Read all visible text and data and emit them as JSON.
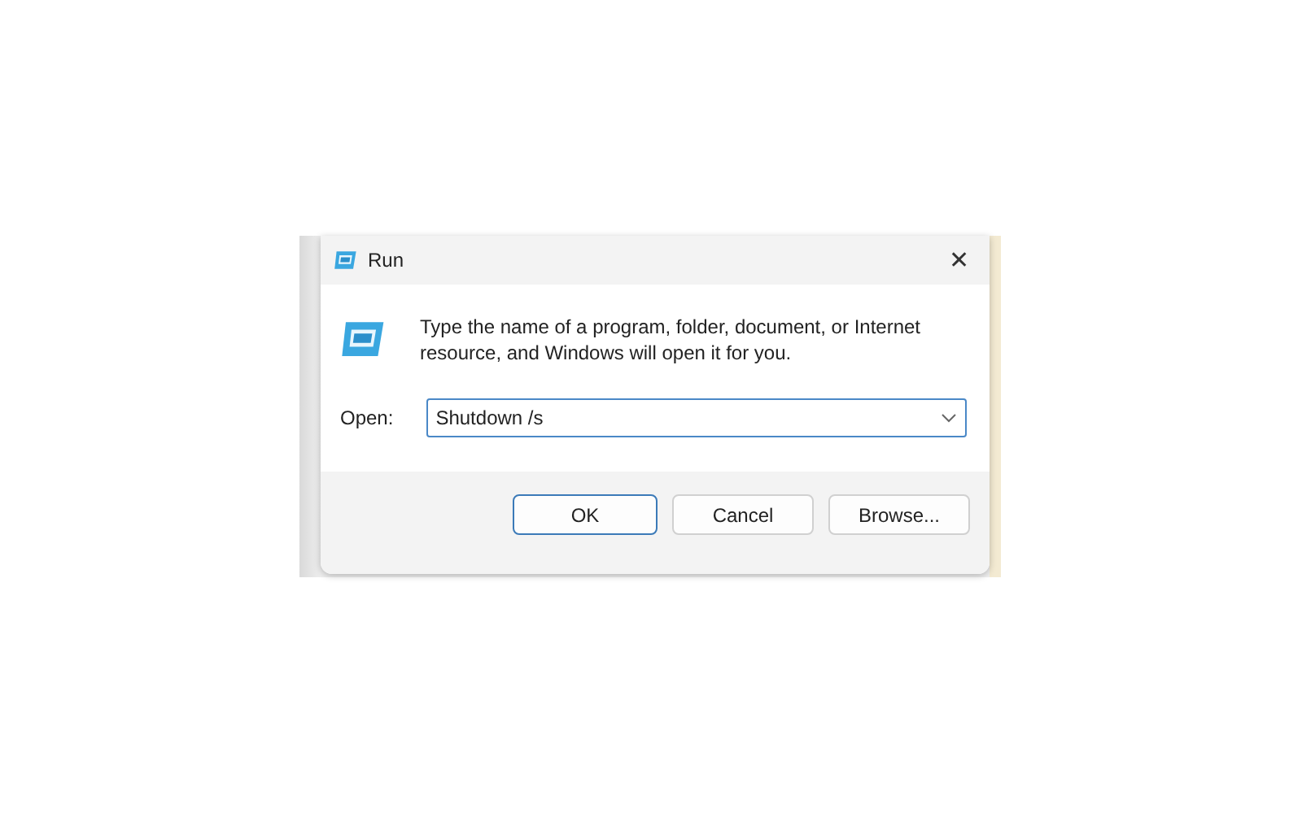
{
  "window": {
    "title": "Run",
    "close": "✕"
  },
  "message": "Type the name of a program, folder, document, or Internet resource, and Windows will open it for you.",
  "open_field": {
    "label": "Open:",
    "value": "Shutdown /s"
  },
  "buttons": [
    {
      "label": "OK",
      "default": true
    },
    {
      "label": "Cancel",
      "default": false
    },
    {
      "label": "Browse...",
      "default": false
    }
  ]
}
